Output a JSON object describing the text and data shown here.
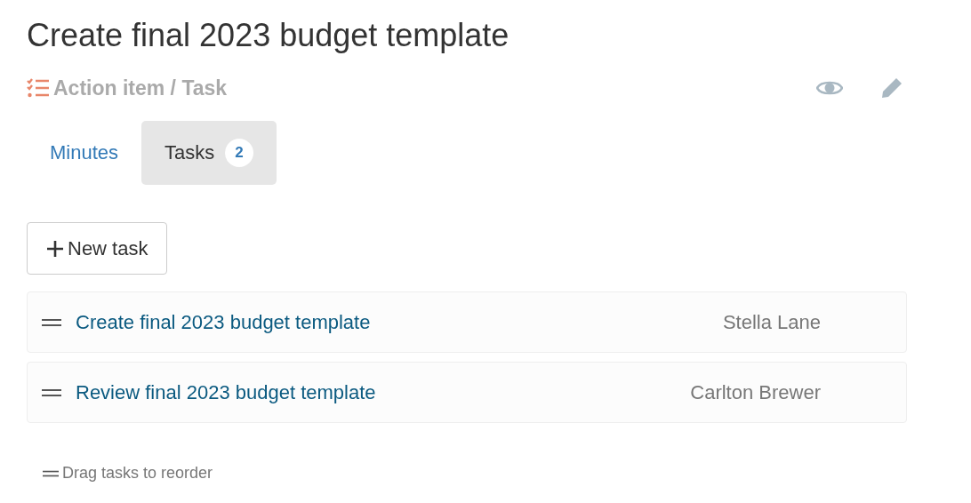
{
  "title": "Create final 2023 budget template",
  "breadcrumb": "Action item / Task",
  "tabs": [
    {
      "label": "Minutes",
      "selected": false
    },
    {
      "label": "Tasks",
      "count": "2",
      "selected": true
    }
  ],
  "new_task_button": "New task",
  "tasks": [
    {
      "title": "Create final 2023 budget template",
      "assignee": "Stella Lane"
    },
    {
      "title": "Review final 2023 budget template",
      "assignee": "Carlton Brewer"
    }
  ],
  "hint": "Drag tasks to reorder"
}
